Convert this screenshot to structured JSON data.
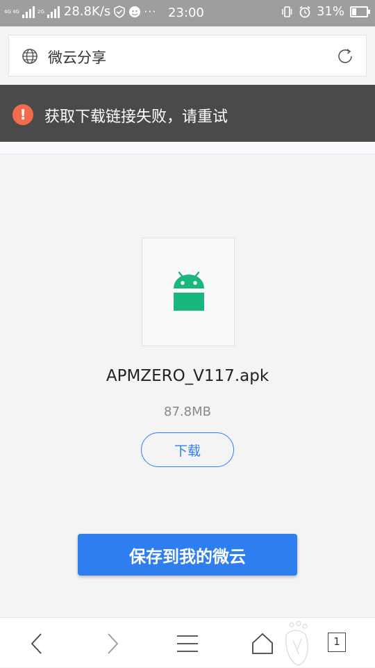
{
  "status_bar": {
    "sim1_tag": "4G 4G",
    "sim2_tag": "2G",
    "net_speed": "28.8K/s",
    "dots": "···",
    "time": "23:00",
    "battery_percent_text": "31%",
    "battery_level": 0.31
  },
  "address_bar": {
    "title": "微云分享",
    "icons": [
      "globe-icon",
      "refresh-icon"
    ]
  },
  "toast": {
    "icon": "!",
    "message": "获取下载链接失败，请重试",
    "icon_color": "#f26b4d"
  },
  "file": {
    "name": "APMZERO_V117.apk",
    "size": "87.8MB",
    "icon": "android-icon",
    "icon_color": "#19b77d"
  },
  "buttons": {
    "download": "下载",
    "save": "保存到我的微云",
    "accent": "#2f7ef0"
  },
  "bottom_nav": {
    "icons": [
      "back-icon",
      "forward-icon",
      "menu-icon",
      "home-icon",
      "tabs-icon"
    ],
    "tab_count": "1"
  }
}
